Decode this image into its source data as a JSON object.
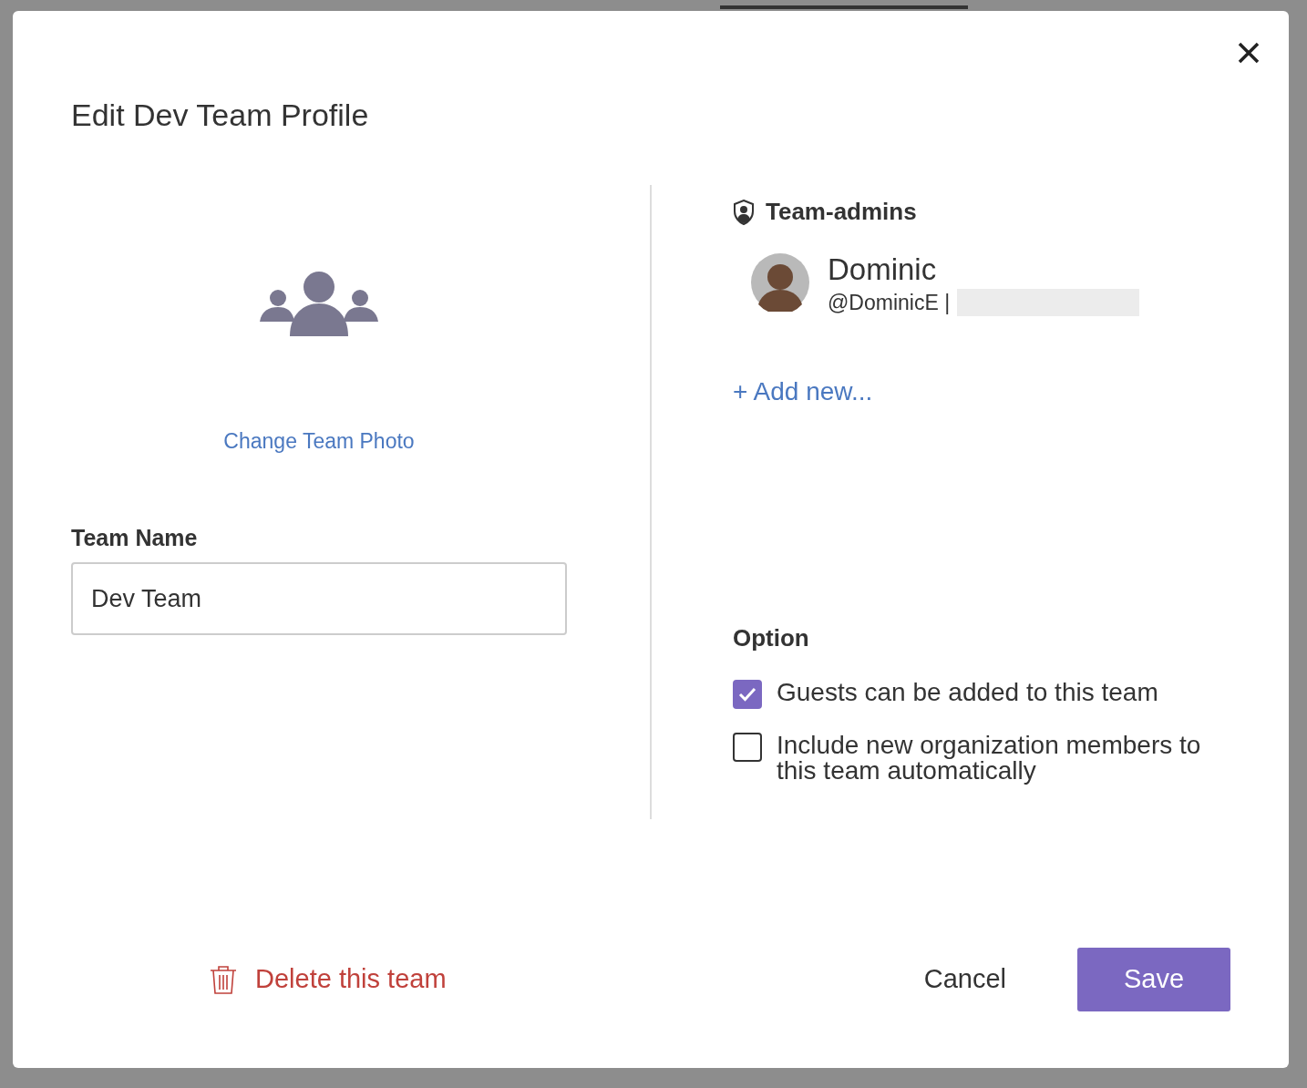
{
  "dialog": {
    "title": "Edit Dev Team Profile"
  },
  "photo": {
    "link": "Change Team Photo"
  },
  "team_name": {
    "label": "Team Name",
    "value": "Dev Team"
  },
  "admins": {
    "heading": "Team-admins",
    "members": [
      {
        "name": "Dominic",
        "handle": "@DominicE |"
      }
    ],
    "add_link": "+ Add new..."
  },
  "options": {
    "heading": "Option",
    "items": [
      {
        "label": "Guests can be added to this team",
        "checked": true
      },
      {
        "label": "Include new organization members to this team automatically",
        "checked": false
      }
    ]
  },
  "footer": {
    "delete": "Delete this team",
    "cancel": "Cancel",
    "save": "Save"
  }
}
